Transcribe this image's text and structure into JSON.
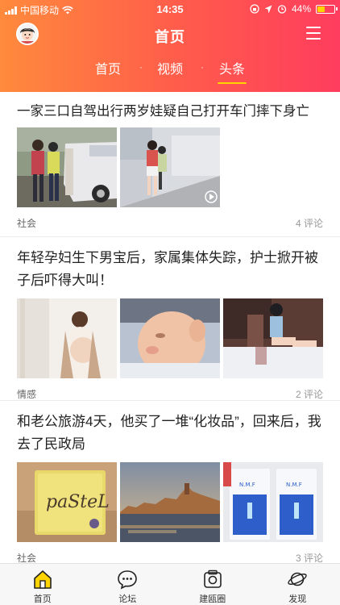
{
  "status_bar": {
    "carrier": "中国移动",
    "time": "14:35",
    "battery": "44%",
    "battery_level": 0.44
  },
  "header": {
    "title": "首页",
    "avatar_icon": "avatar-icon",
    "menu_icon": "menu-icon"
  },
  "tabs": [
    {
      "label": "首页",
      "active": false
    },
    {
      "label": "视频",
      "active": false
    },
    {
      "label": "头条",
      "active": true
    }
  ],
  "tab_separator": "·",
  "articles": [
    {
      "title": "一家三口自驾出行两岁娃疑自己打开车门摔下身亡",
      "category": "社会",
      "comments": "4 评论"
    },
    {
      "title": "年轻孕妇生下男宝后，家属集体失踪，护士掀开被子后吓得大叫！",
      "category": "情感",
      "comments": "2 评论"
    },
    {
      "title": "和老公旅游4天，他买了一堆“化妆品”，回来后，我去了民政局",
      "category": "社会",
      "comments": "3 评论"
    }
  ],
  "bottom_nav": [
    {
      "label": "首页",
      "icon": "home-icon"
    },
    {
      "label": "论坛",
      "icon": "forum-icon"
    },
    {
      "label": "建瓯圈",
      "icon": "camera-circle-icon"
    },
    {
      "label": "发现",
      "icon": "planet-icon"
    }
  ],
  "colors": {
    "header_start": "#ff8a3c",
    "header_end": "#ff3d5e",
    "tab_indicator": "#ffd400"
  }
}
